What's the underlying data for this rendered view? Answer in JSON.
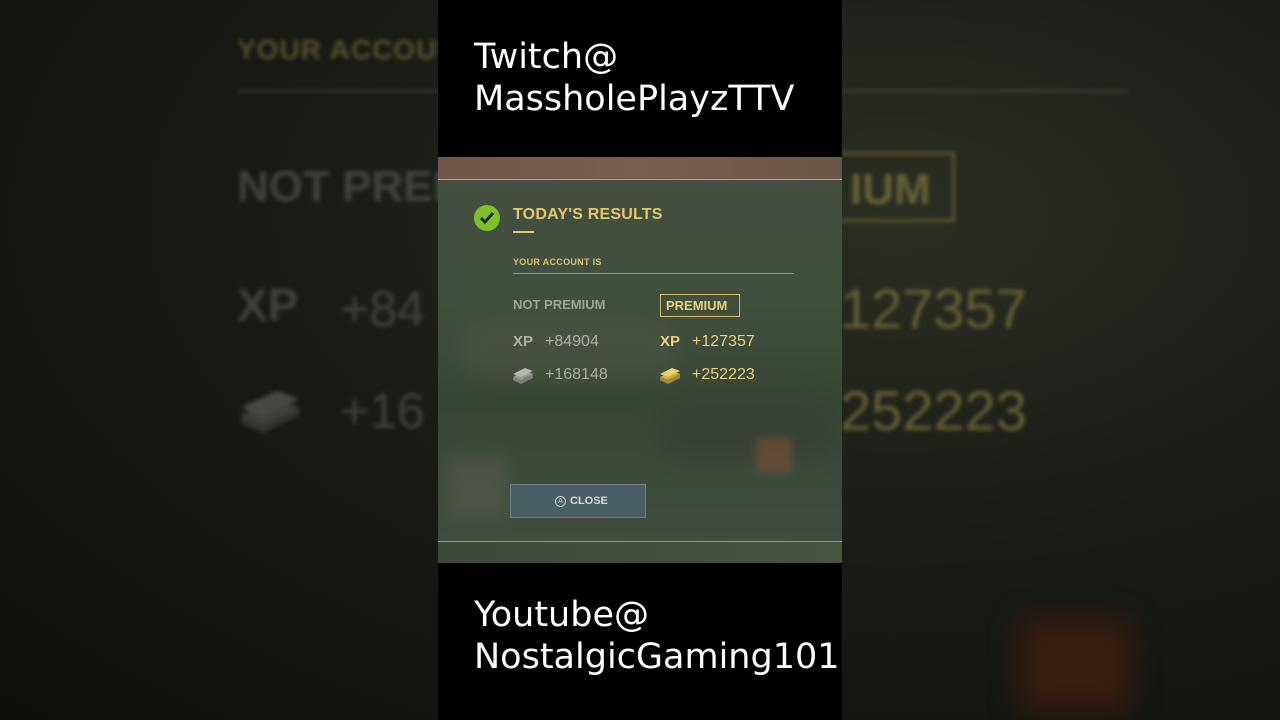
{
  "captions": {
    "top_line1": "Twitch@",
    "top_line2": "MassholePlayzTTV",
    "bottom_line1": "Youtube@",
    "bottom_line2": "NostalgicGaming101"
  },
  "dialog": {
    "title": "TODAY'S RESULTS",
    "account_label": "YOUR ACCOUNT IS",
    "not_premium_label": "NOT PREMIUM",
    "premium_label": "PREMIUM",
    "xp_label": "XP",
    "not_premium": {
      "xp": "+84904",
      "credits": "+168148"
    },
    "premium": {
      "xp": "+127357",
      "credits": "+252223"
    },
    "close_label": "CLOSE",
    "close_key_glyph": "A"
  },
  "background": {
    "title": "YOUR ACCOUN",
    "not_premium": "NOT PREM",
    "premium": "IUM",
    "xp": "XP",
    "xp_np": "+84",
    "xp_p": "127357",
    "cr_np": "+16",
    "cr_p": "252223"
  },
  "colors": {
    "gold": "#e2c86a",
    "check_green": "#7cc02a",
    "muted": "#9ea49a"
  }
}
